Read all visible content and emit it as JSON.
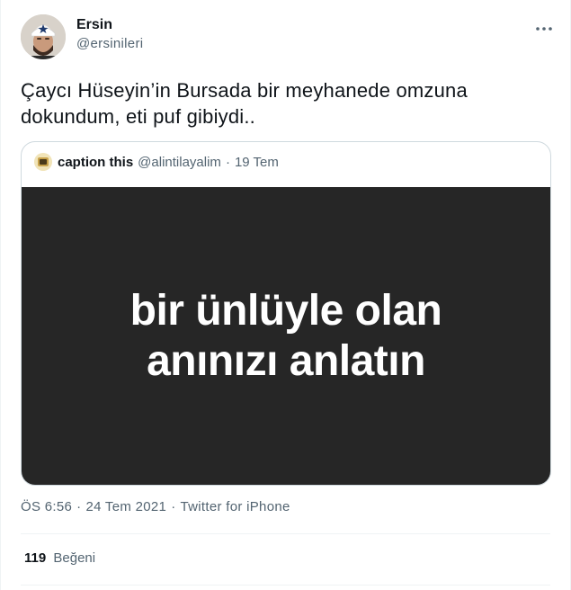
{
  "author": {
    "display_name": "Ersin",
    "username": "@ersinileri"
  },
  "tweet": {
    "text": "Çaycı Hüseyin’in Bursada bir meyhanede omzuna dokundum, eti puf gibiydi.."
  },
  "quote": {
    "display_name": "caption this",
    "username": "@alintilayalim",
    "separator": "·",
    "date": "19 Tem",
    "image_text_line1": "bir ünlüyle olan",
    "image_text_line2": "anınızı anlatın"
  },
  "meta": {
    "time": "ÖS 6:56",
    "dot1": "·",
    "date": "24 Tem 2021",
    "dot2": "·",
    "source": "Twitter for iPhone"
  },
  "stats": {
    "likes_count": "119",
    "likes_label": "Beğeni"
  },
  "icons": {
    "more": "more-horizontal-icon"
  },
  "colors": {
    "text_primary": "#0f1419",
    "text_secondary": "#536471",
    "border": "#cfd9de",
    "image_bg": "#262626"
  }
}
